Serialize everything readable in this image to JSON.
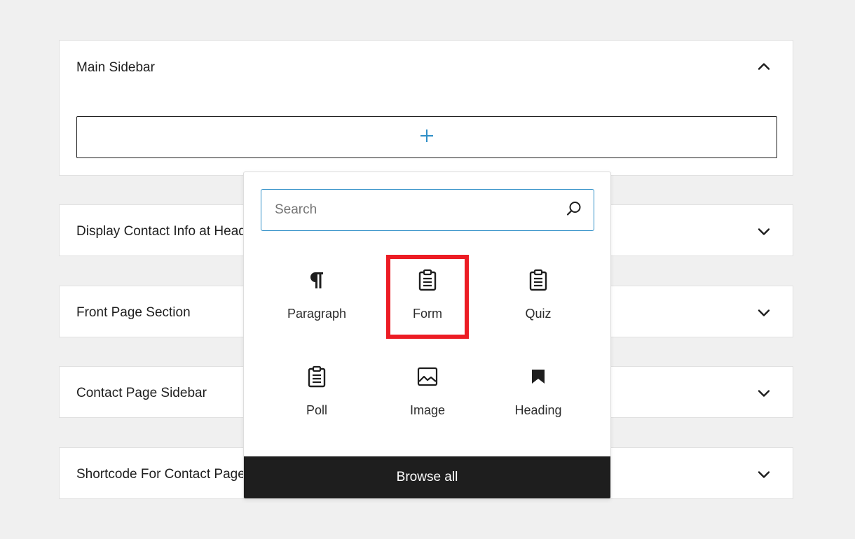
{
  "widget_areas": [
    {
      "title": "Main Sidebar",
      "expanded": true
    },
    {
      "title": "Display Contact Info at Header",
      "expanded": false
    },
    {
      "title": "Front Page Section",
      "expanded": false
    },
    {
      "title": "Contact Page Sidebar",
      "expanded": false
    },
    {
      "title": "Shortcode For Contact Page",
      "expanded": false
    }
  ],
  "add_block_icon": "plus-icon",
  "inserter": {
    "search_placeholder": "Search",
    "blocks": [
      {
        "label": "Paragraph",
        "icon": "paragraph-icon"
      },
      {
        "label": "Form",
        "icon": "clipboard-icon",
        "highlighted": true
      },
      {
        "label": "Quiz",
        "icon": "clipboard-icon"
      },
      {
        "label": "Poll",
        "icon": "clipboard-icon"
      },
      {
        "label": "Image",
        "icon": "image-icon"
      },
      {
        "label": "Heading",
        "icon": "bookmark-icon"
      }
    ],
    "browse_all_label": "Browse all"
  },
  "colors": {
    "accent": "#2f8fc7",
    "highlight": "#ec1c24",
    "dark": "#1e1e1e",
    "background": "#f0f0f0"
  }
}
